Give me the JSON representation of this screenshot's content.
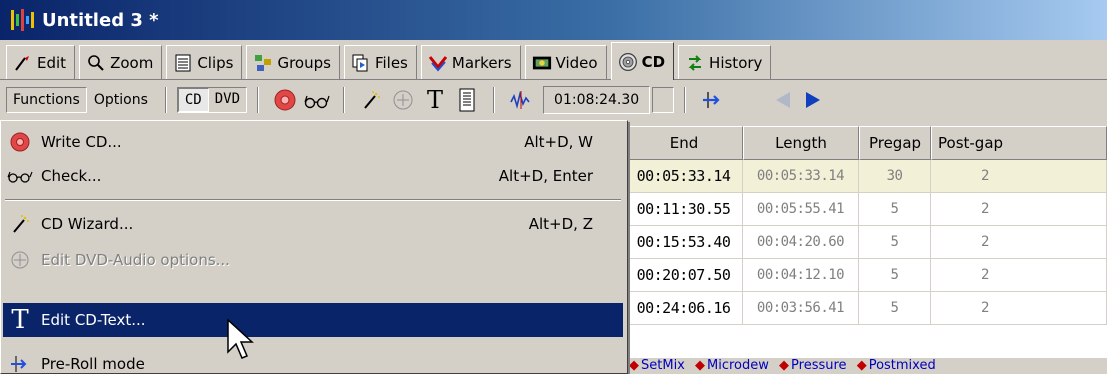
{
  "window": {
    "title": "Untitled 3 *"
  },
  "tabs": [
    {
      "label": "Edit",
      "icon": "edit-icon"
    },
    {
      "label": "Zoom",
      "icon": "zoom-icon"
    },
    {
      "label": "Clips",
      "icon": "clips-icon"
    },
    {
      "label": "Groups",
      "icon": "groups-icon"
    },
    {
      "label": "Files",
      "icon": "files-icon"
    },
    {
      "label": "Markers",
      "icon": "markers-icon"
    },
    {
      "label": "Video",
      "icon": "video-icon"
    },
    {
      "label": "CD",
      "icon": "cd-icon",
      "active": true
    },
    {
      "label": "History",
      "icon": "history-icon"
    }
  ],
  "toolbar": {
    "functions": "Functions",
    "options": "Options",
    "cd": "CD",
    "dvd": "DVD",
    "time": "01:08:24.30"
  },
  "table": {
    "headers": [
      "End",
      "Length",
      "Pregap",
      "Post-gap"
    ],
    "rows": [
      [
        "00:05:33.14",
        "00:05:33.14",
        "30",
        "2"
      ],
      [
        "00:11:30.55",
        "00:05:55.41",
        "5",
        "2"
      ],
      [
        "00:15:53.40",
        "00:04:20.60",
        "5",
        "2"
      ],
      [
        "00:20:07.50",
        "00:04:12.10",
        "5",
        "2"
      ],
      [
        "00:24:06.16",
        "00:03:56.41",
        "5",
        "2"
      ]
    ]
  },
  "markers_bar": [
    "SetMix",
    "Microdew",
    "Pressure",
    "Postmixed"
  ],
  "menu": {
    "items": [
      {
        "label": "Write CD...",
        "shortcut": "Alt+D, W"
      },
      {
        "label": "Check...",
        "shortcut": "Alt+D, Enter"
      },
      {
        "label": "CD Wizard...",
        "shortcut": "Alt+D, Z"
      },
      {
        "label": "Edit DVD-Audio options...",
        "shortcut": ""
      },
      {
        "label": "Edit CD-Text...",
        "shortcut": ""
      },
      {
        "label": "Pre-Roll mode",
        "shortcut": ""
      }
    ]
  },
  "colors": {
    "highlight": "#0a246a",
    "titlebar": "#0a246a",
    "face": "#d4d0c8",
    "selected_row": "#f3f0d8"
  }
}
